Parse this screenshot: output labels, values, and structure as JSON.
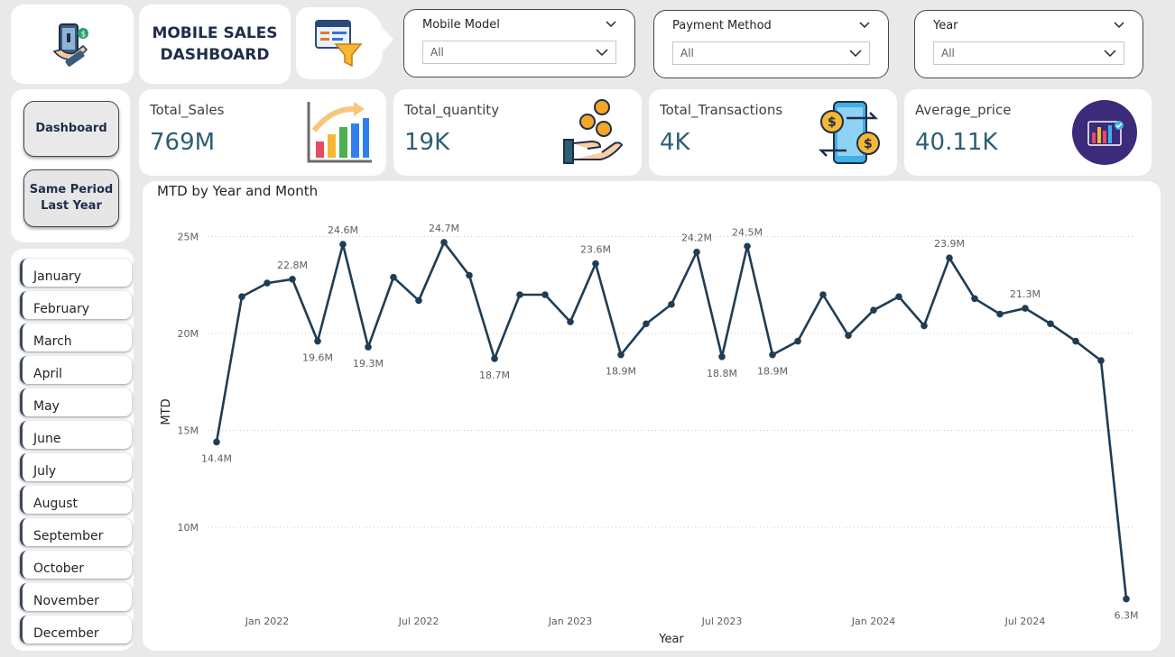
{
  "header": {
    "title_line1": "MOBILE SALES",
    "title_line2": "DASHBOARD",
    "logo_icon": "mobile-payment-icon",
    "filter_icon": "filter-funnel-icon"
  },
  "filters": [
    {
      "label": "Mobile Model",
      "value": "All"
    },
    {
      "label": "Payment Method",
      "value": "All"
    },
    {
      "label": "Year",
      "value": "All"
    }
  ],
  "nav": {
    "dashboard": "Dashboard",
    "same_period_line1": "Same Period",
    "same_period_line2": "Last Year"
  },
  "months": [
    "January",
    "February",
    "March",
    "April",
    "May",
    "June",
    "July",
    "August",
    "September",
    "October",
    "November",
    "December"
  ],
  "kpis": [
    {
      "label": "Total_Sales",
      "value": "769M",
      "icon": "bar-chart-growth-icon"
    },
    {
      "label": "Total_quantity",
      "value": "19K",
      "icon": "coins-hand-icon"
    },
    {
      "label": "Total_Transactions",
      "value": "4K",
      "icon": "money-transfer-phone-icon"
    },
    {
      "label": "Average_price",
      "value": "40.11K",
      "icon": "analytics-chart-icon"
    }
  ],
  "colors": {
    "line": "#1f3d55",
    "accent": "#2e5e73",
    "title": "#1f2d4a"
  },
  "chart_data": {
    "type": "line",
    "title": "MTD by Year and Month",
    "xlabel": "Year",
    "ylabel": "MTD",
    "ylim": [
      6,
      26
    ],
    "y_ticks": [
      10,
      15,
      20,
      25
    ],
    "y_tick_labels": [
      "10M",
      "15M",
      "20M",
      "25M"
    ],
    "x_ticks": [
      "Jan 2022",
      "Jul 2022",
      "Jan 2023",
      "Jul 2023",
      "Jan 2024",
      "Jul 2024"
    ],
    "grid": true,
    "units": "M",
    "x": [
      "2021-11",
      "2021-12",
      "2022-01",
      "2022-02",
      "2022-03",
      "2022-04",
      "2022-05",
      "2022-06",
      "2022-07",
      "2022-08",
      "2022-09",
      "2022-10",
      "2022-11",
      "2022-12",
      "2023-01",
      "2023-02",
      "2023-03",
      "2023-04",
      "2023-05",
      "2023-06",
      "2023-07",
      "2023-08",
      "2023-09",
      "2023-10",
      "2023-11",
      "2023-12",
      "2024-01",
      "2024-02",
      "2024-03",
      "2024-04",
      "2024-05",
      "2024-06",
      "2024-07",
      "2024-08",
      "2024-09",
      "2024-10"
    ],
    "values": [
      14.4,
      21.9,
      22.6,
      22.8,
      19.6,
      24.6,
      19.3,
      22.9,
      21.7,
      24.7,
      23.0,
      18.7,
      22.0,
      22.0,
      20.6,
      23.6,
      18.9,
      20.5,
      21.5,
      24.2,
      18.8,
      24.5,
      18.9,
      19.6,
      22.0,
      19.9,
      21.2,
      21.9,
      20.4,
      23.9,
      21.8,
      21.0,
      21.3,
      20.5,
      19.6,
      18.6,
      6.3
    ],
    "labels": {
      "0": "14.4M",
      "3": "22.8M",
      "4": "19.6M",
      "5": "24.6M",
      "6": "19.3M",
      "9": "24.7M",
      "11": "18.7M",
      "15": "23.6M",
      "16": "18.9M",
      "19": "24.2M",
      "20": "18.8M",
      "21": "24.5M",
      "22": "18.9M",
      "29": "23.9M",
      "32": "21.3M",
      "36": "6.3M"
    }
  }
}
